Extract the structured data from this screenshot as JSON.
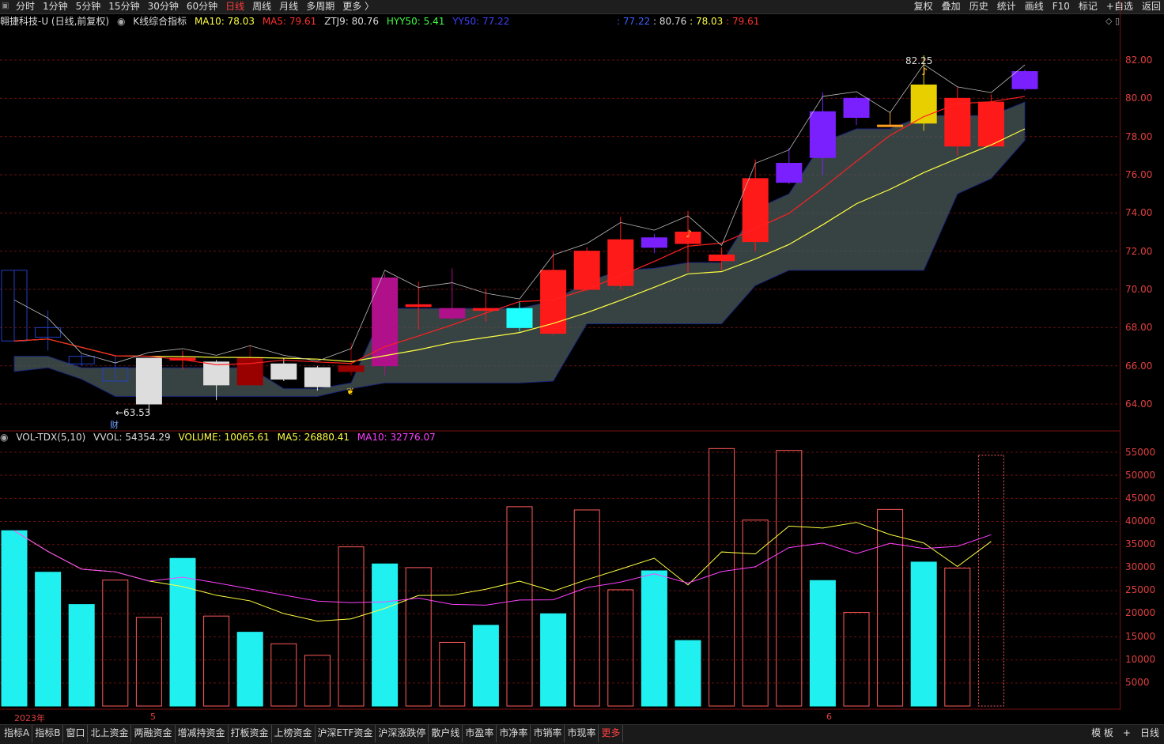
{
  "toolbar": {
    "periods": [
      "分时",
      "1分钟",
      "5分钟",
      "15分钟",
      "30分钟",
      "60分钟",
      "日线",
      "周线",
      "月线",
      "多周期",
      "更多 〉"
    ],
    "active_period": "日线",
    "tools": [
      "复权",
      "叠加",
      "历史",
      "统计",
      "画线",
      "F10",
      "标记",
      "+自选",
      "返回"
    ]
  },
  "info": {
    "stock": "翱捷科技-U (日线,前复权)",
    "indicator": "K线综合指标",
    "ma10": "MA10: 78.03",
    "ma5": "MA5: 79.61",
    "ztj9": "ZTJ9: 80.76",
    "hyy50": "HYY50: 5.41",
    "yy50": "YY50: 77.22",
    "right_values": [
      ": 77.22",
      ": 80.76",
      ": 78.03",
      ": 79.61"
    ]
  },
  "vol_info": {
    "name": "VOL-TDX(5,10)",
    "vvol": "VVOL: 54354.29",
    "volume": "VOLUME: 10065.61",
    "ma5": "MA5: 26880.41",
    "ma10": "MA10: 32776.07"
  },
  "price_ticks": [
    "82.00",
    "80.00",
    "78.00",
    "76.00",
    "74.00",
    "72.00",
    "70.00",
    "68.00",
    "66.00",
    "64.00"
  ],
  "vol_ticks": [
    "55000",
    "50000",
    "45000",
    "40000",
    "35000",
    "30000",
    "25000",
    "20000",
    "15000",
    "10000",
    "5000"
  ],
  "annotations": {
    "high": "82.25",
    "low": "←63.53",
    "cai": "财"
  },
  "x_labels": [
    "2023年",
    "5",
    "6"
  ],
  "bottom_tabs": [
    "指标A",
    "指标B",
    "窗口",
    "北上资金",
    "两融资金",
    "增减持资金",
    "打板资金",
    "上榜资金",
    "沪深ETF资金",
    "沪深涨跌停",
    "散户线",
    "市盈率",
    "市净率",
    "市销率",
    "市现率",
    "更多"
  ],
  "bottom_right": [
    "模 板",
    "+",
    "日线"
  ],
  "colors": {
    "up": "#ff2020",
    "down": "#00ffff",
    "ma5": "#ff2020",
    "ma10": "#ffff40",
    "grid": "#7a1010"
  },
  "chart_data": {
    "type": "candlestick",
    "price_ylim": [
      63.0,
      83.0
    ],
    "vol_ylim": [
      0,
      56000
    ],
    "candles": [
      {
        "o": 71.0,
        "c": 67.3,
        "h": 71.0,
        "l": 67.3,
        "color": "blue"
      },
      {
        "o": 68.0,
        "c": 67.5,
        "h": 68.9,
        "l": 66.8,
        "color": "blue"
      },
      {
        "o": 66.5,
        "c": 66.1,
        "h": 66.6,
        "l": 66.0,
        "color": "blue"
      },
      {
        "o": 65.9,
        "c": 65.2,
        "h": 66.5,
        "l": 65.3,
        "color": "blue"
      },
      {
        "o": 64.0,
        "c": 66.4,
        "h": 66.4,
        "l": 63.53,
        "color": "white"
      },
      {
        "o": 66.3,
        "c": 66.4,
        "h": 66.8,
        "l": 65.8,
        "color": "red"
      },
      {
        "o": 65.0,
        "c": 66.2,
        "h": 66.3,
        "l": 64.2,
        "color": "white"
      },
      {
        "o": 65.0,
        "c": 66.4,
        "h": 67.1,
        "l": 65.0,
        "color": "darkred"
      },
      {
        "o": 65.3,
        "c": 66.1,
        "h": 66.4,
        "l": 65.2,
        "color": "white"
      },
      {
        "o": 64.9,
        "c": 65.9,
        "h": 66.0,
        "l": 64.7,
        "color": "white"
      },
      {
        "o": 65.7,
        "c": 66.0,
        "h": 67.2,
        "l": 65.5,
        "color": "darkred"
      },
      {
        "o": 66.0,
        "c": 70.6,
        "h": 70.8,
        "l": 65.5,
        "color": "magenta"
      },
      {
        "o": 69.1,
        "c": 69.2,
        "h": 70.4,
        "l": 67.9,
        "color": "red"
      },
      {
        "o": 68.5,
        "c": 69.0,
        "h": 71.1,
        "l": 68.4,
        "color": "magenta"
      },
      {
        "o": 68.9,
        "c": 69.0,
        "h": 70.0,
        "l": 68.3,
        "color": "red"
      },
      {
        "o": 68.0,
        "c": 69.0,
        "h": 69.4,
        "l": 67.8,
        "color": "cyan"
      },
      {
        "o": 67.7,
        "c": 71.0,
        "h": 72.0,
        "l": 67.6,
        "color": "red"
      },
      {
        "o": 70.0,
        "c": 72.0,
        "h": 72.2,
        "l": 69.9,
        "color": "red"
      },
      {
        "o": 70.2,
        "c": 72.6,
        "h": 73.8,
        "l": 70.0,
        "color": "red"
      },
      {
        "o": 72.2,
        "c": 72.7,
        "h": 72.9,
        "l": 71.9,
        "color": "purple"
      },
      {
        "o": 72.4,
        "c": 73.0,
        "h": 74.1,
        "l": 70.9,
        "color": "red"
      },
      {
        "o": 71.5,
        "c": 71.8,
        "h": 72.2,
        "l": 71.0,
        "color": "red"
      },
      {
        "o": 72.5,
        "c": 75.8,
        "h": 76.8,
        "l": 72.0,
        "color": "red"
      },
      {
        "o": 75.6,
        "c": 76.6,
        "h": 77.4,
        "l": 75.5,
        "color": "purple"
      },
      {
        "o": 76.9,
        "c": 79.3,
        "h": 80.3,
        "l": 76.0,
        "color": "purple"
      },
      {
        "o": 79.0,
        "c": 80.0,
        "h": 80.1,
        "l": 78.6,
        "color": "purple"
      },
      {
        "o": 78.6,
        "c": 78.6,
        "h": 79.3,
        "l": 78.5,
        "color": "orange"
      },
      {
        "o": 78.7,
        "c": 80.7,
        "h": 82.25,
        "l": 78.3,
        "color": "yellow"
      },
      {
        "o": 77.5,
        "c": 80.0,
        "h": 80.6,
        "l": 77.0,
        "color": "red"
      },
      {
        "o": 77.5,
        "c": 79.8,
        "h": 80.2,
        "l": 77.5,
        "color": "red"
      },
      {
        "o": 80.5,
        "c": 81.4,
        "h": 81.5,
        "l": 80.4,
        "color": "purple"
      }
    ],
    "volume": [
      38000,
      29000,
      22000,
      27300,
      19200,
      32000,
      19500,
      16000,
      13500,
      11000,
      34500,
      30800,
      30000,
      13800,
      17500,
      43200,
      20000,
      42500,
      25200,
      29300,
      14200,
      55800,
      40300,
      55400,
      27200,
      20300,
      42600,
      31200,
      29900,
      54354
    ],
    "volume_filled": [
      true,
      true,
      true,
      false,
      false,
      true,
      false,
      true,
      false,
      false,
      false,
      true,
      false,
      false,
      true,
      false,
      true,
      false,
      false,
      true,
      true,
      false,
      false,
      false,
      true,
      false,
      false,
      true,
      false,
      false
    ]
  }
}
